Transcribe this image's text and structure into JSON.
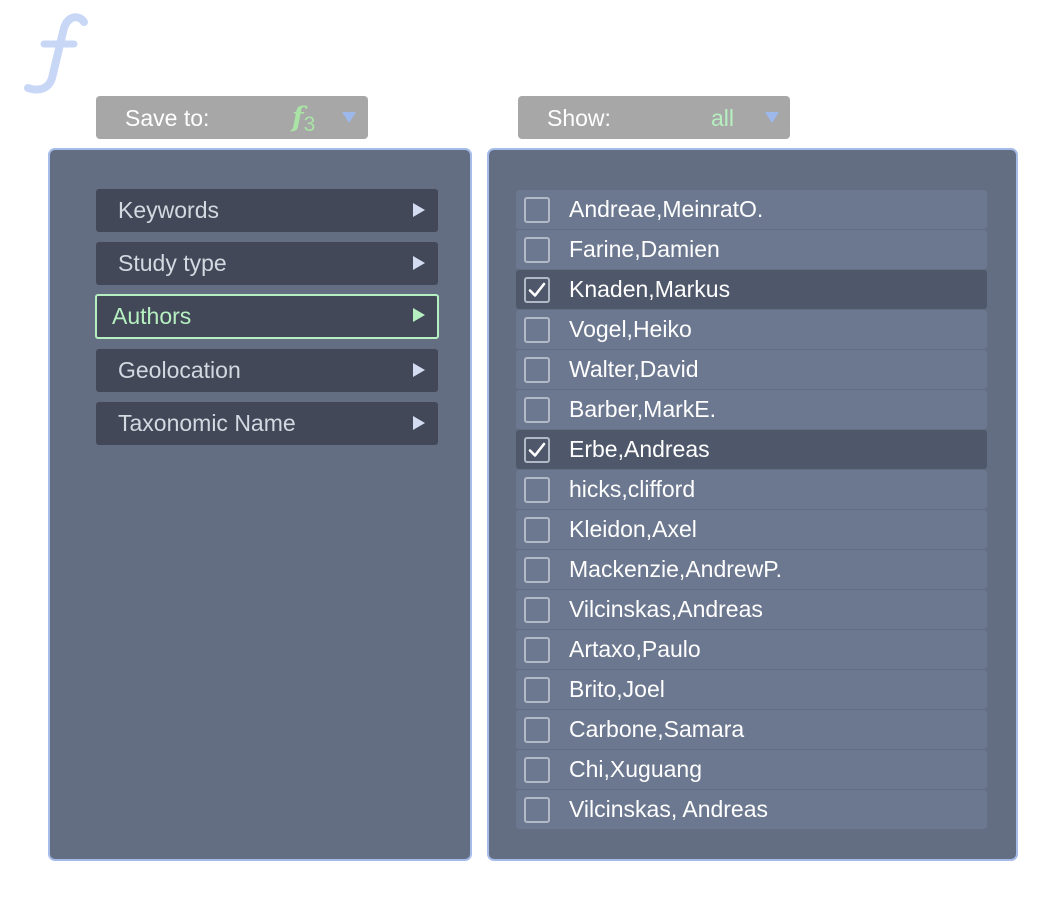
{
  "logo": {
    "icon": "function-f-logo-icon"
  },
  "save_dropdown": {
    "label": "Save to:",
    "value_letter": "f",
    "value_sub": "3",
    "caret_icon": "chevron-down-icon"
  },
  "show_dropdown": {
    "label": "Show:",
    "value": "all",
    "caret_icon": "chevron-down-icon"
  },
  "categories": [
    {
      "label": "Keywords",
      "active": false
    },
    {
      "label": "Study type",
      "active": false
    },
    {
      "label": "Authors",
      "active": true
    },
    {
      "label": "Geolocation",
      "active": false
    },
    {
      "label": "Taxonomic Name",
      "active": false
    }
  ],
  "authors": [
    {
      "name": "Andreae,MeinratO.",
      "checked": false
    },
    {
      "name": "Farine,Damien",
      "checked": false
    },
    {
      "name": "Knaden,Markus",
      "checked": true
    },
    {
      "name": "Vogel,Heiko",
      "checked": false
    },
    {
      "name": "Walter,David",
      "checked": false
    },
    {
      "name": "Barber,MarkE.",
      "checked": false
    },
    {
      "name": "Erbe,Andreas",
      "checked": true
    },
    {
      "name": "hicks,clifford",
      "checked": false
    },
    {
      "name": "Kleidon,Axel",
      "checked": false
    },
    {
      "name": "Mackenzie,AndrewP.",
      "checked": false
    },
    {
      "name": "Vilcinskas,Andreas",
      "checked": false
    },
    {
      "name": "Artaxo,Paulo",
      "checked": false
    },
    {
      "name": "Brito,Joel",
      "checked": false
    },
    {
      "name": "Carbone,Samara",
      "checked": false
    },
    {
      "name": "Chi,Xuguang",
      "checked": false
    },
    {
      "name": "Vilcinskas, Andreas",
      "checked": false
    }
  ],
  "colors": {
    "panel_bg": "#636e83",
    "panel_border": "#a5bce8",
    "accent_green": "#b6efc0",
    "logo_blue": "#c8d7f6"
  }
}
